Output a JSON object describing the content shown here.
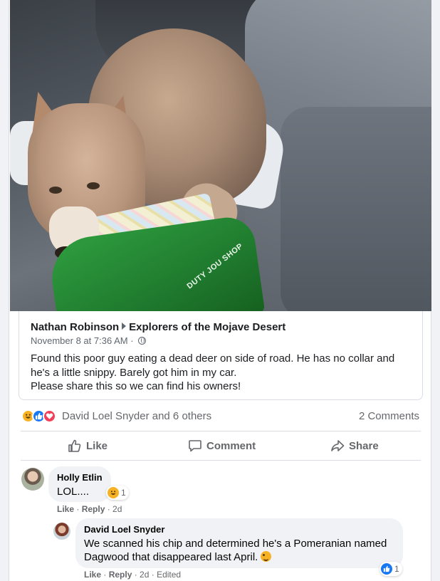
{
  "post": {
    "author": "Nathan Robinson",
    "group": "Explorers of the Mojave Desert",
    "timestamp": "November 8 at 7:36 AM",
    "separator": "·",
    "privacy_icon": "globe-icon",
    "text_lines": [
      "Found this poor guy eating a dead deer on side of road. He has no collar and",
      "he's a little snippy. Barely got him in my car.",
      "Please share this so we can find his owners!"
    ],
    "photo_bag_text": "DUTY JOU SHOP"
  },
  "reactions": {
    "icons": [
      "haha-reaction-icon",
      "like-reaction-icon",
      "love-reaction-icon"
    ],
    "names": "David Loel Snyder and 6 others",
    "comments_count": "2 Comments"
  },
  "actions": {
    "like": "Like",
    "comment": "Comment",
    "share": "Share"
  },
  "comments": [
    {
      "author": "Holly Etlin",
      "text_lines": [
        "LOL...."
      ],
      "reaction_count": "1",
      "like_label": "Like",
      "reply_label": "Reply",
      "age": "2d"
    },
    {
      "author": "David Loel Snyder",
      "text_lines": [
        "We scanned his chip and determined he's a Pomeranian named",
        "Dagwood that disappeared last April."
      ],
      "reaction_count": "1",
      "like_label": "Like",
      "reply_label": "Reply",
      "age": "2d",
      "edited": "Edited"
    }
  ],
  "colors": {
    "brand": "#1877f2",
    "love": "#f33e58",
    "haha": "#f7b125",
    "secondary_text": "#65676b"
  }
}
